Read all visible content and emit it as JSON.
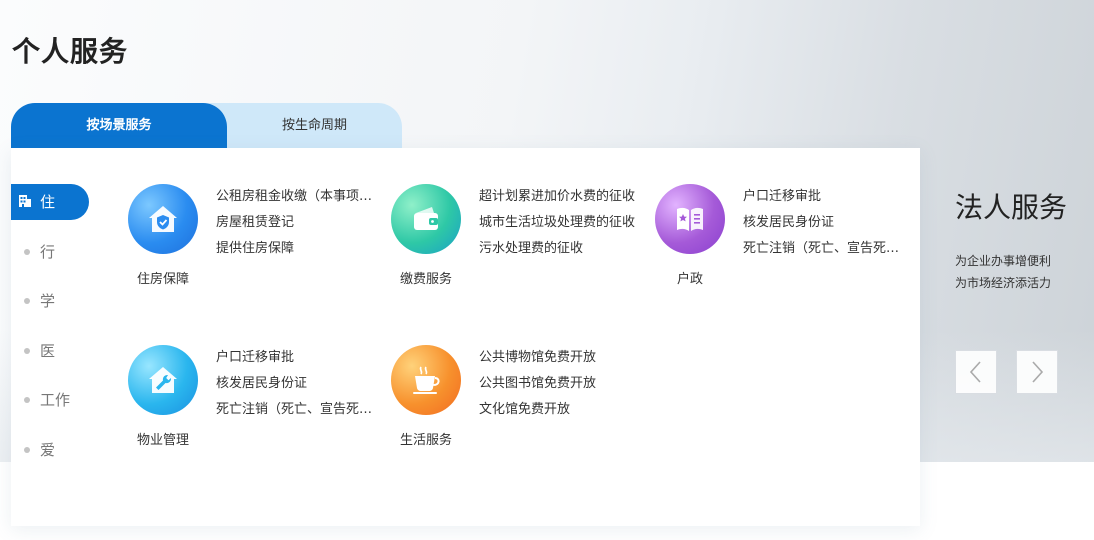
{
  "page_title": "个人服务",
  "tabs": [
    {
      "label": "按场景服务",
      "active": true
    },
    {
      "label": "按生命周期",
      "active": false
    }
  ],
  "side_nav": [
    {
      "label": "住",
      "active": true
    },
    {
      "label": "行"
    },
    {
      "label": "学"
    },
    {
      "label": "医"
    },
    {
      "label": "工作"
    },
    {
      "label": "爱"
    }
  ],
  "categories": [
    {
      "name": "住房保障",
      "icon": "house-shield-icon",
      "color": "#2a8cf0",
      "items": [
        "公租房租金收缴（本事项不...",
        "房屋租赁登记",
        "提供住房保障"
      ]
    },
    {
      "name": "缴费服务",
      "icon": "wallet-icon",
      "color": "#27c4b0",
      "items": [
        "超计划累进加价水费的征收",
        "城市生活垃圾处理费的征收",
        "污水处理费的征收"
      ]
    },
    {
      "name": "户政",
      "icon": "book-star-icon",
      "color": "#a55ad8",
      "items": [
        "户口迁移审批",
        "核发居民身份证",
        "死亡注销（死亡、宣告死亡..."
      ]
    },
    {
      "name": "物业管理",
      "icon": "house-wrench-icon",
      "color": "#28b4ea",
      "items": [
        "户口迁移审批",
        "核发居民身份证",
        "死亡注销（死亡、宣告死亡..."
      ]
    },
    {
      "name": "生活服务",
      "icon": "coffee-cup-icon",
      "color": "#f7912d",
      "items": [
        "公共博物馆免费开放",
        "公共图书馆免费开放",
        "文化馆免费开放"
      ]
    }
  ],
  "legal": {
    "title": "法人服务",
    "desc_lines": [
      "为企业办事增便利",
      "为市场经济添活力"
    ]
  }
}
